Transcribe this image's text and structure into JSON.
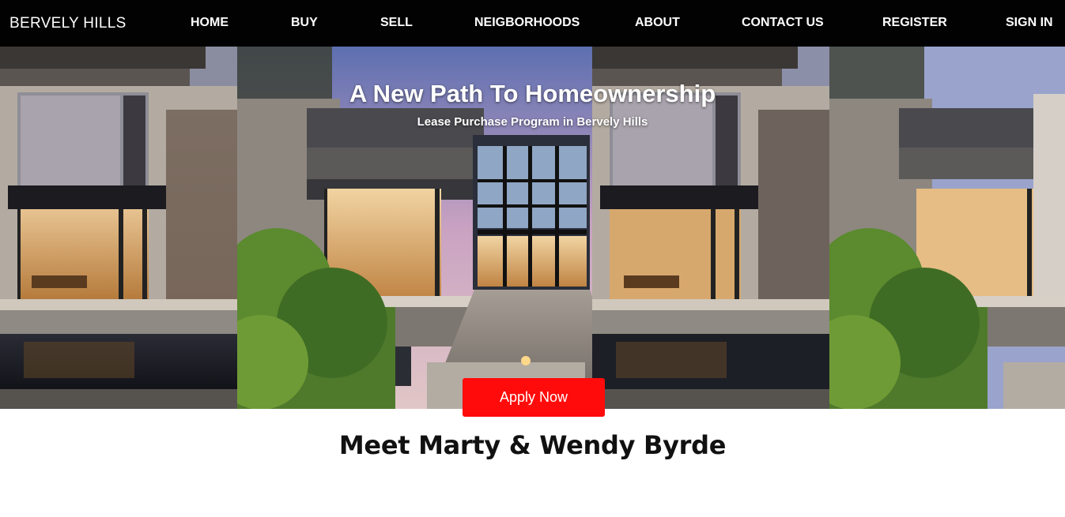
{
  "navbar": {
    "brand": "BERVELY HILLS",
    "links": [
      {
        "label": "HOME"
      },
      {
        "label": "BUY"
      },
      {
        "label": "SELL"
      },
      {
        "label": "NEIGBORHOODS"
      },
      {
        "label": "ABOUT"
      },
      {
        "label": "CONTACT US"
      },
      {
        "label": "REGISTER"
      },
      {
        "label": "SIGN IN"
      }
    ]
  },
  "hero": {
    "title": "A New Path To Homeownership",
    "subtitle": "Lease Purchase Program in Bervely Hills",
    "cta_label": "Apply Now"
  },
  "section": {
    "heading": "Meet Marty & Wendy Byrde"
  },
  "colors": {
    "navbar_bg": "#020202",
    "cta_bg": "#ff0b0b",
    "text_light": "#ffffff"
  }
}
